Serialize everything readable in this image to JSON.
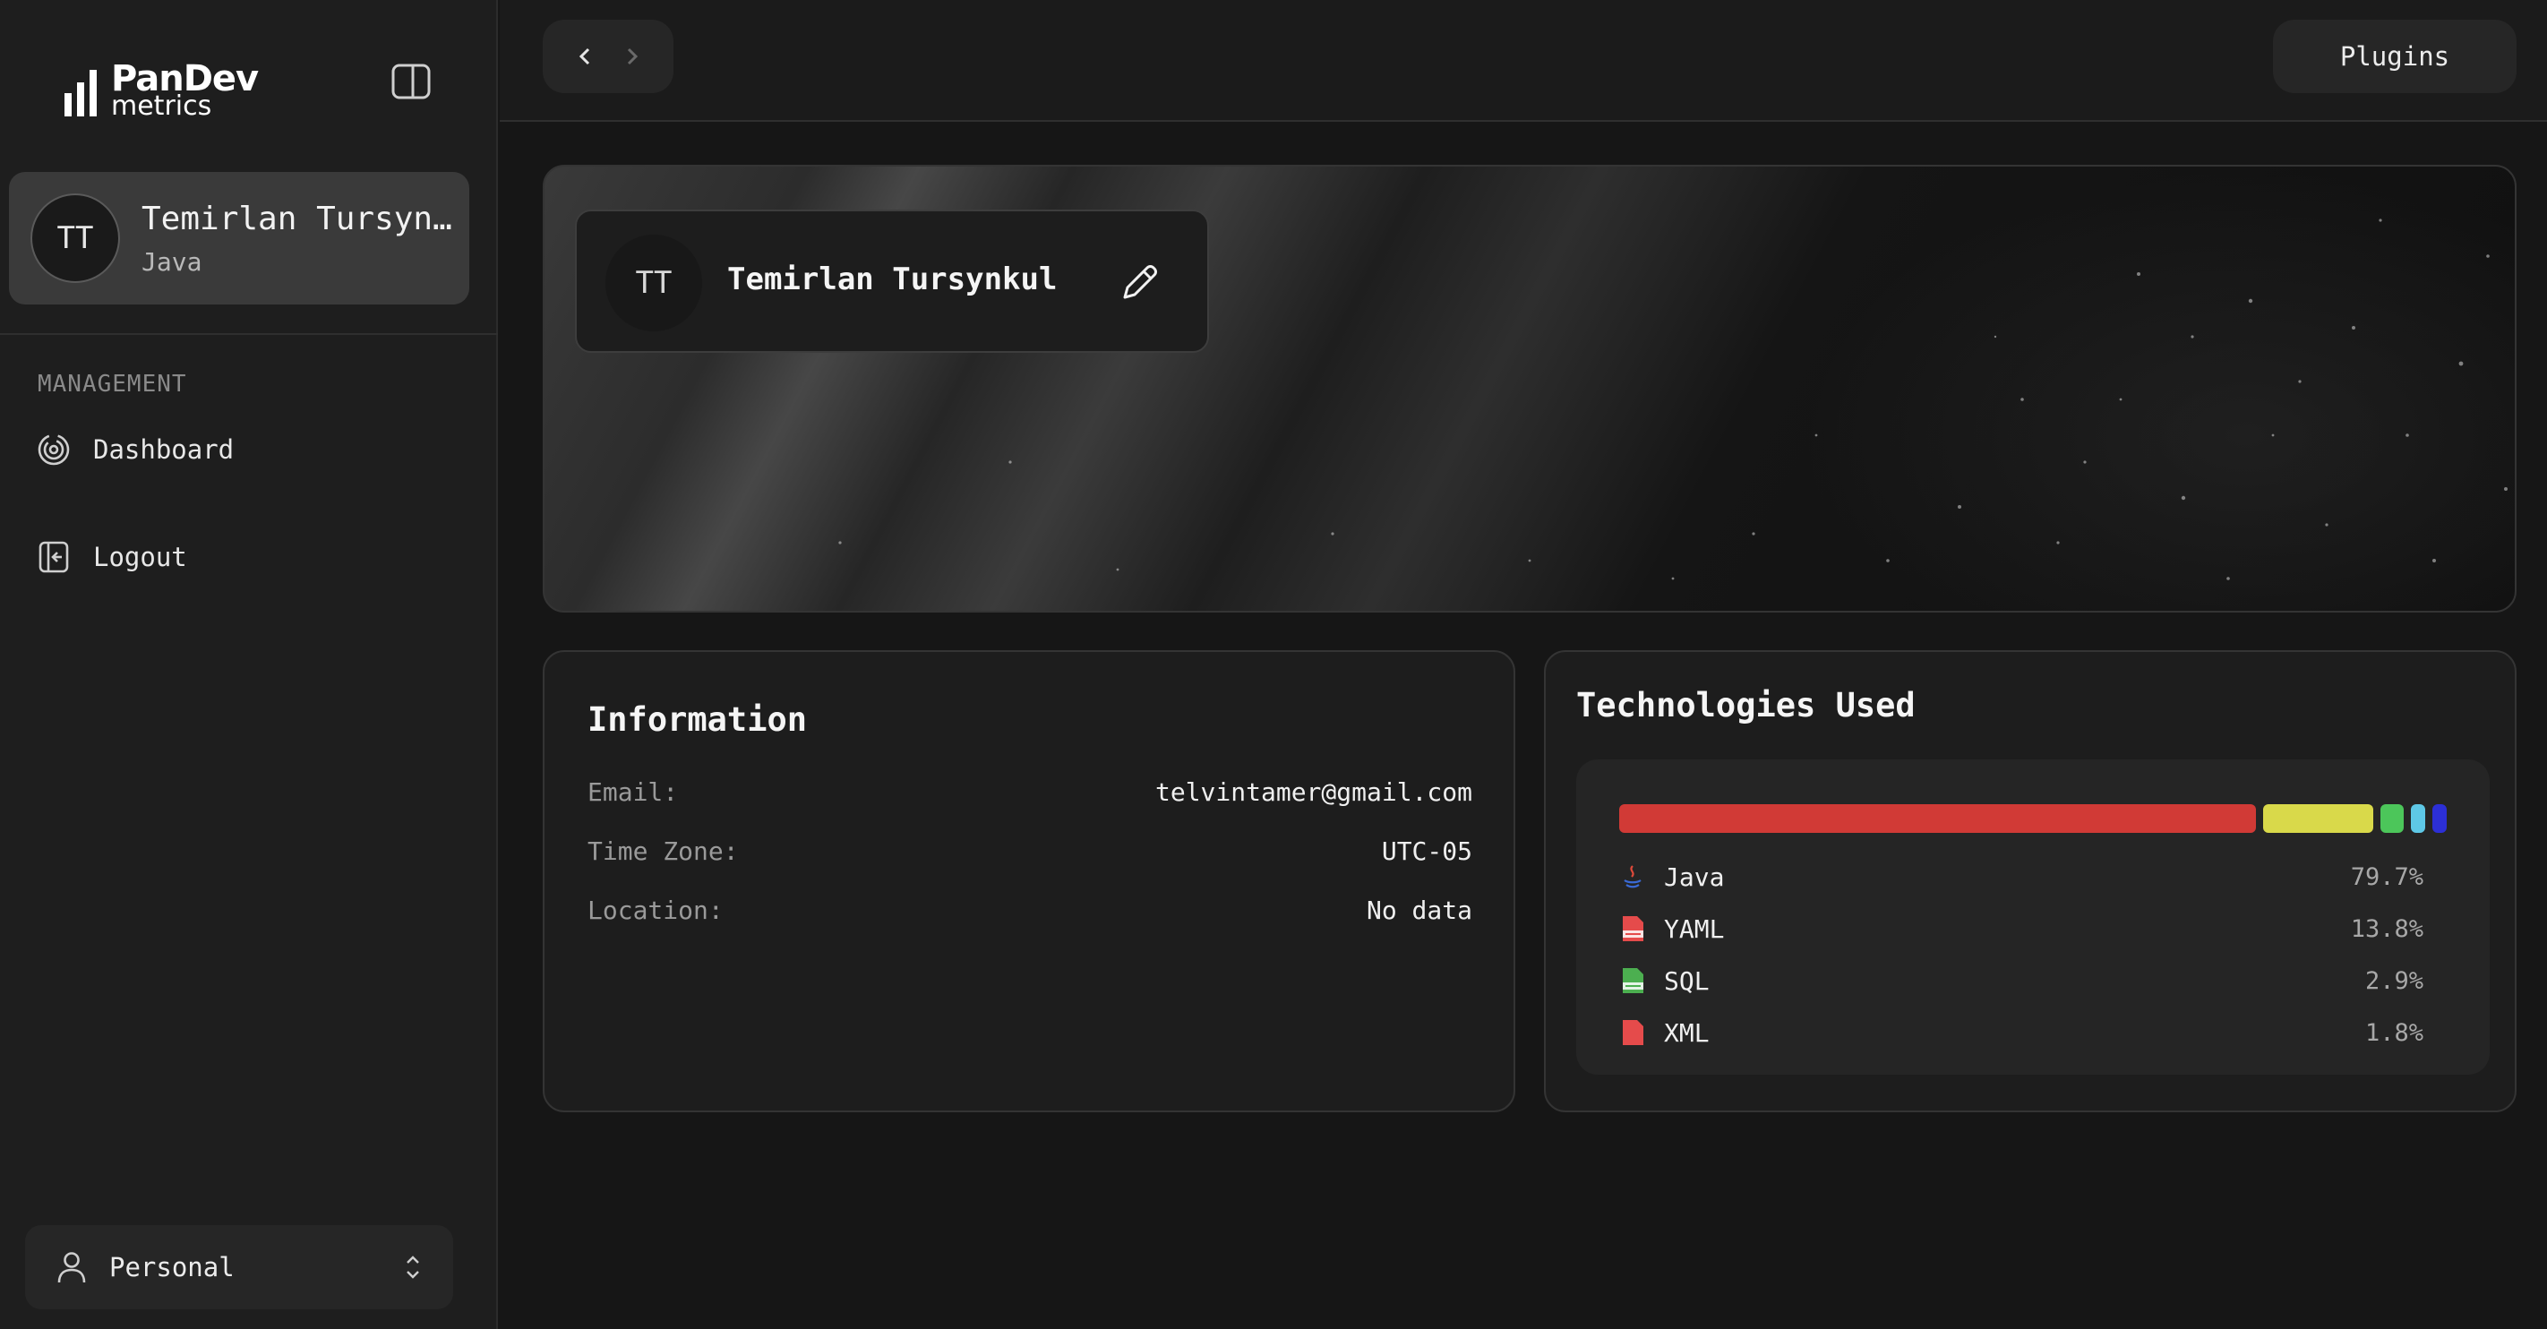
{
  "sidebar": {
    "logo_brand": "PanDev",
    "logo_sub": "metrics",
    "user": {
      "initials": "TT",
      "name": "Temirlan Tursynkul",
      "language": "Java"
    },
    "section_label": "MANAGEMENT",
    "nav": [
      {
        "label": "Dashboard",
        "icon": "dashboard-icon"
      },
      {
        "label": "Logout",
        "icon": "logout-icon"
      }
    ],
    "workspace": {
      "label": "Personal",
      "icon": "user-icon"
    }
  },
  "topbar": {
    "back_icon": "chevron-left-icon",
    "forward_icon": "chevron-right-icon",
    "plugins_label": "Plugins"
  },
  "profile": {
    "initials": "TT",
    "name": "Temirlan Tursynkul",
    "edit_icon": "pencil-icon"
  },
  "information": {
    "title": "Information",
    "rows": [
      {
        "key": "Email:",
        "value": "telvintamer@gmail.com"
      },
      {
        "key": "Time Zone:",
        "value": "UTC-05"
      },
      {
        "key": "Location:",
        "value": "No data"
      }
    ]
  },
  "technologies": {
    "title": "Technologies Used",
    "items": [
      {
        "name": "Java",
        "percent": "79.7%",
        "share": 79.7,
        "color": "#d13a36",
        "icon": "java-icon"
      },
      {
        "name": "YAML",
        "percent": "13.8%",
        "share": 13.8,
        "color": "#d9d94a",
        "icon": "yaml-file-icon"
      },
      {
        "name": "SQL",
        "percent": "2.9%",
        "share": 2.9,
        "color": "#4cc65a",
        "icon": "sql-file-icon"
      },
      {
        "name": "XML",
        "percent": "1.8%",
        "share": 1.8,
        "color": "#5ec8e6",
        "icon": "xml-file-icon"
      },
      {
        "name": "",
        "percent": "",
        "share": 1.8,
        "color": "#2c2fd6",
        "icon": ""
      }
    ]
  }
}
